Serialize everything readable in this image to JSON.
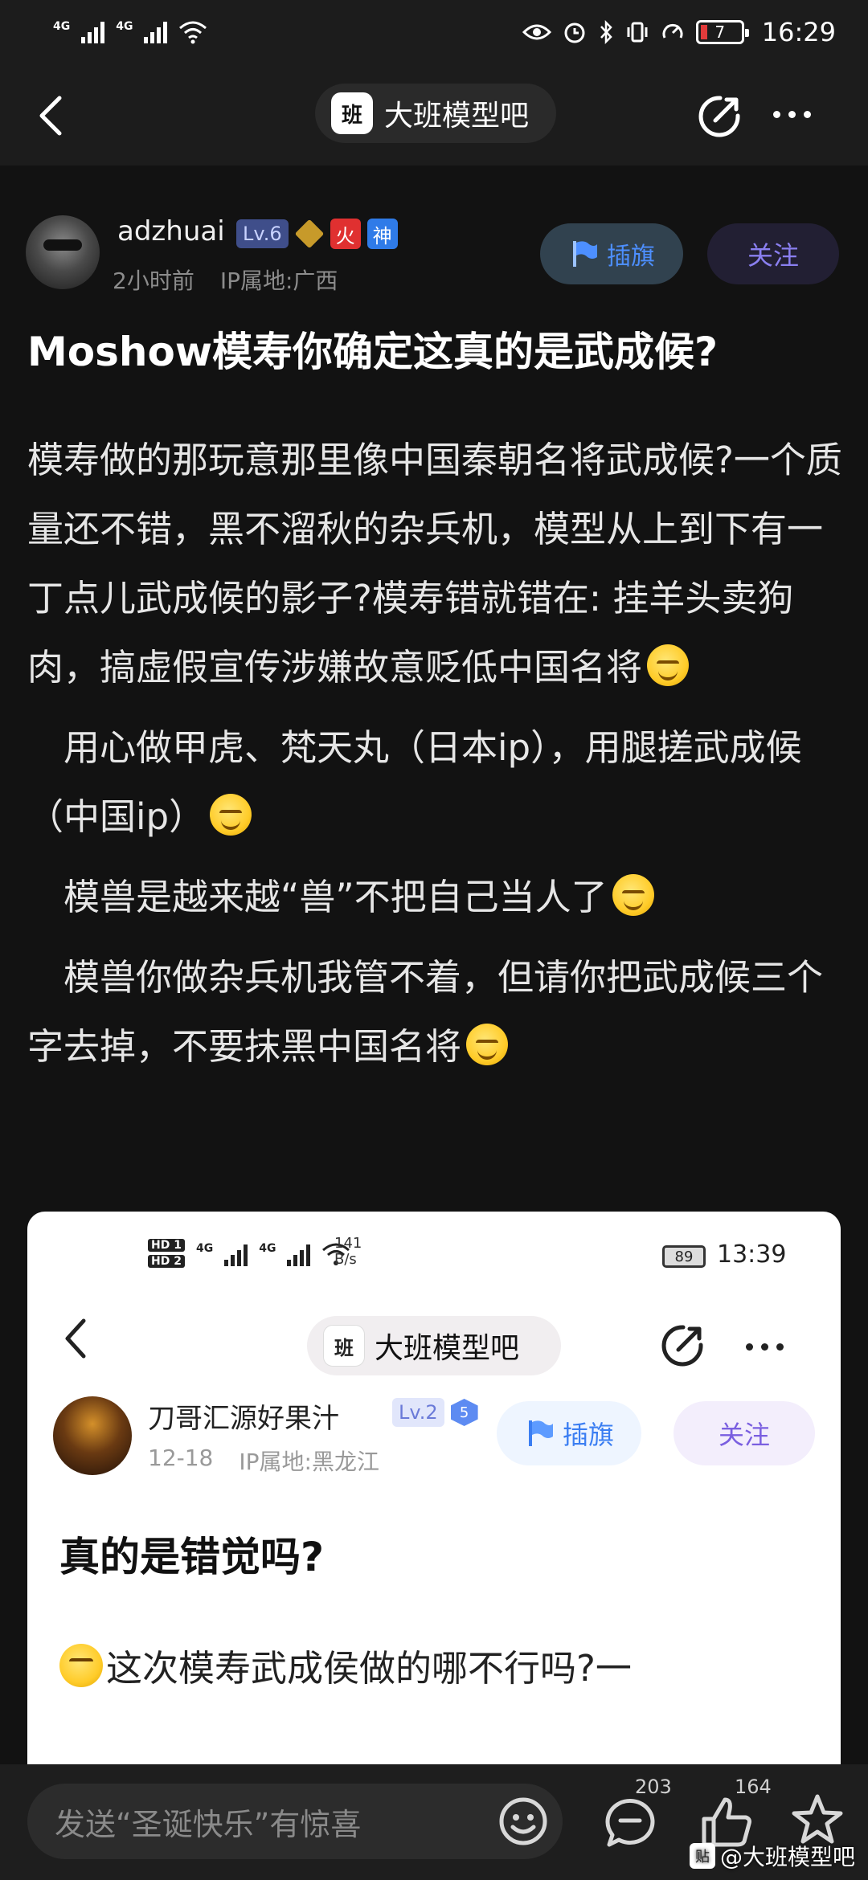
{
  "status_bar": {
    "signal_1": "4G",
    "signal_2": "4G",
    "battery": "7",
    "time": "16:29"
  },
  "nav": {
    "forum_name": "大班模型吧",
    "forum_logo_text": "班"
  },
  "author": {
    "username": "adzhuai",
    "level": "Lv.6",
    "badge_fire": "火",
    "badge_god": "神",
    "time_ago": "2小时前",
    "ip_location": "IP属地:广西",
    "flag_label": "插旗",
    "follow_label": "关注"
  },
  "post": {
    "title": "Moshow模寿你确定这真的是武成候?",
    "paragraphs": [
      "模寿做的那玩意那里像中国秦朝名将武成候?一个质量还不错，黑不溜秋的杂兵机，模型从上到下有一丁点儿武成候的影子?模寿错就错在: 挂羊头卖狗肉，搞虚假宣传涉嫌故意贬低中国名将",
      "用心做甲虎、梵天丸（日本ip），用腿搓武成候（中国ip）",
      "模兽是越来越“兽”不把自己当人了",
      "模兽你做杂兵机我管不着，但请你把武成候三个字去掉，不要抹黑中国名将"
    ]
  },
  "embedded": {
    "status": {
      "hd1": "HD 1",
      "hd2": "HD 2",
      "net1": "4G",
      "net2": "4G",
      "speed_value": "141",
      "speed_unit": "B/s",
      "battery": "89",
      "time": "13:39"
    },
    "forum_name": "大班模型吧",
    "forum_logo_text": "班",
    "username": "刀哥汇源好果汁",
    "level": "Lv.2",
    "badge_num": "5",
    "date": "12-18",
    "ip_location": "IP属地:黑龙江",
    "flag_label": "插旗",
    "follow_label": "关注",
    "title": "真的是错觉吗?",
    "body_first_line": "这次模寿武成侯做的哪不行吗?一"
  },
  "bottom_bar": {
    "comment_placeholder": "发送“圣诞快乐”有惊喜",
    "comment_count": "203",
    "like_count": "164",
    "watermark": "@大班模型吧",
    "watermark_logo": "贴"
  },
  "colors": {
    "background": "#121212",
    "accent_purple": "#8a7ff0",
    "flag_blue": "#4d8fff",
    "fire_red": "#e03030"
  }
}
